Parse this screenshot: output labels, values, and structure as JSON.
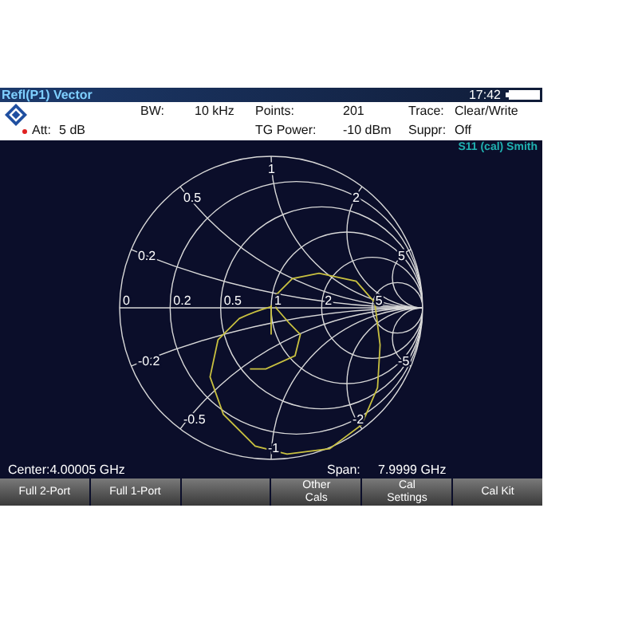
{
  "title_bar": {
    "title": "Refl(P1) Vector",
    "time": "17:42"
  },
  "info": {
    "att": {
      "label": "Att:",
      "value": "5 dB"
    },
    "row1": [
      {
        "label": "BW:",
        "value": "10 kHz"
      },
      {
        "label": "Points:",
        "value": "201"
      },
      {
        "label": "Trace:",
        "value": "Clear/Write"
      }
    ],
    "row2": [
      {
        "label": "TG Power:",
        "value": "-10 dBm"
      },
      {
        "label": "Suppr:",
        "value": "Off"
      }
    ]
  },
  "chart": {
    "title": "S11 (cal) Smith",
    "labels": [
      {
        "kind": "resistance",
        "text": "0"
      },
      {
        "kind": "resistance",
        "text": "0.2"
      },
      {
        "kind": "resistance",
        "text": "0.5"
      },
      {
        "kind": "resistance",
        "text": "1"
      },
      {
        "kind": "resistance",
        "text": "2"
      },
      {
        "kind": "resistance",
        "text": "5"
      },
      {
        "kind": "reactance",
        "text": "0.5"
      },
      {
        "kind": "reactance",
        "text": "0.2"
      },
      {
        "kind": "reactance",
        "text": "1"
      },
      {
        "kind": "reactance",
        "text": "2"
      },
      {
        "kind": "reactance",
        "text": "5"
      },
      {
        "kind": "reactance",
        "text": "-0.2"
      },
      {
        "kind": "reactance",
        "text": "-0.5"
      },
      {
        "kind": "reactance",
        "text": "-1"
      },
      {
        "kind": "reactance",
        "text": "-2"
      },
      {
        "kind": "reactance",
        "text": "-5"
      }
    ]
  },
  "status": {
    "center": "Center:4.00005 GHz",
    "span_label": "Span:",
    "span_value": "7.9999 GHz"
  },
  "softkeys": [
    {
      "kind": "label",
      "lines": [
        "Full 2-Port"
      ]
    },
    {
      "kind": "label",
      "lines": [
        "Full 1-Port"
      ]
    },
    {
      "kind": "blank"
    },
    {
      "kind": "label",
      "lines": [
        "Other",
        "Cals"
      ]
    },
    {
      "kind": "label",
      "lines": [
        "Cal",
        "Settings"
      ]
    },
    {
      "kind": "label",
      "lines": [
        "Cal Kit"
      ]
    }
  ]
}
